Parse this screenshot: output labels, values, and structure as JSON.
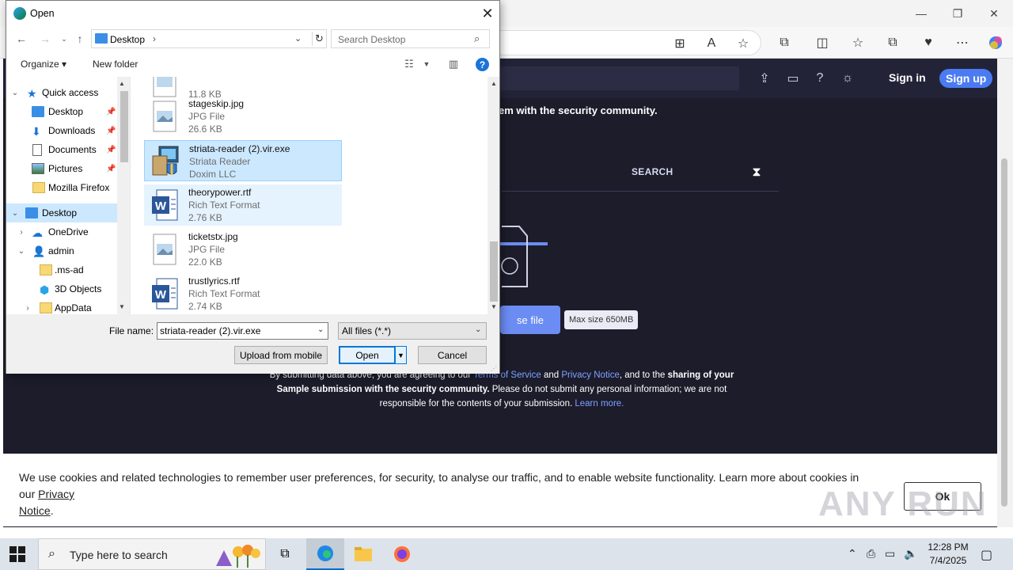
{
  "browser": {
    "window_controls": {
      "minimize": "—",
      "restore": "❐",
      "close": "✕"
    }
  },
  "site": {
    "sign_in": "Sign in",
    "sign_up": "Sign up",
    "line_share": "em with the security community.",
    "search_tab": "SEARCH",
    "choose_file": "se file",
    "max_size": "Max size 650MB",
    "terms": {
      "p1": "By submitting data above, you are agreeing to our ",
      "tos": "Terms of Service",
      "and": " and ",
      "privacy": "Privacy Notice",
      "p2": ", and to the ",
      "bold1": "sharing of your",
      "bold2": "Sample submission with the security community.",
      "p3": " Please do not submit any personal information; we are not responsible for the contents of your submission. ",
      "learn": "Learn more."
    },
    "cookie_text": "We use cookies and related technologies to remember user preferences, for security, to analyse our traffic, and to enable website functionality. Learn more about cookies in our ",
    "cookie_link_1": "Privacy",
    "cookie_link_2": "Notice",
    "cookie_end": ".",
    "ok": "Ok",
    "watermark": "ANY RUN"
  },
  "dialog": {
    "title": "Open",
    "path": "Desktop",
    "search_placeholder": "Search Desktop",
    "organize": "Organize ▾",
    "new_folder": "New folder",
    "nav": [
      {
        "label": "Quick access",
        "icon": "star-icon",
        "pinned": false,
        "selected": false
      },
      {
        "label": "Desktop",
        "icon": "desktop-icon",
        "pinned": true,
        "selected": false
      },
      {
        "label": "Downloads",
        "icon": "download-icon",
        "pinned": true,
        "selected": false
      },
      {
        "label": "Documents",
        "icon": "document-icon",
        "pinned": true,
        "selected": false
      },
      {
        "label": "Pictures",
        "icon": "picture-icon",
        "pinned": true,
        "selected": false
      },
      {
        "label": "Mozilla Firefox",
        "icon": "folder-icon",
        "pinned": false,
        "selected": false
      },
      {
        "label": "Desktop",
        "icon": "desktop-icon",
        "pinned": false,
        "selected": true
      },
      {
        "label": "OneDrive",
        "icon": "cloud-icon",
        "pinned": false,
        "selected": false
      },
      {
        "label": "admin",
        "icon": "user-icon",
        "pinned": false,
        "selected": false
      },
      {
        "label": ".ms-ad",
        "icon": "folder-icon",
        "pinned": false,
        "selected": false
      },
      {
        "label": "3D Objects",
        "icon": "cube-icon",
        "pinned": false,
        "selected": false
      },
      {
        "label": "AppData",
        "icon": "folder-icon",
        "pinned": false,
        "selected": false
      }
    ],
    "files": [
      {
        "name": "",
        "type": "",
        "size": "11.8 KB",
        "kind": "jpg",
        "state": "none"
      },
      {
        "name": "stageskip.jpg",
        "type": "JPG File",
        "size": "26.6 KB",
        "kind": "jpg",
        "state": "none"
      },
      {
        "name": "striata-reader (2).vir.exe",
        "type": "Striata Reader",
        "size": "Doxim LLC",
        "kind": "exe",
        "state": "selected"
      },
      {
        "name": "theorypower.rtf",
        "type": "Rich Text Format",
        "size": "2.76 KB",
        "kind": "rtf",
        "state": "hover"
      },
      {
        "name": "ticketstx.jpg",
        "type": "JPG File",
        "size": "22.0 KB",
        "kind": "jpg",
        "state": "none"
      },
      {
        "name": "trustlyrics.rtf",
        "type": "Rich Text Format",
        "size": "2.74 KB",
        "kind": "rtf",
        "state": "none"
      }
    ],
    "file_name_label": "File name:",
    "file_name_value": "striata-reader (2).vir.exe",
    "file_type": "All files (*.*)",
    "upload_mobile": "Upload from mobile",
    "open": "Open",
    "cancel": "Cancel"
  },
  "taskbar": {
    "search_placeholder": "Type here to search",
    "time": "12:28 PM",
    "date": "7/4/2025"
  },
  "colors": {
    "accent": "#0078d7",
    "site_bg": "#1c1c2b",
    "signup": "#4a7bf2"
  }
}
